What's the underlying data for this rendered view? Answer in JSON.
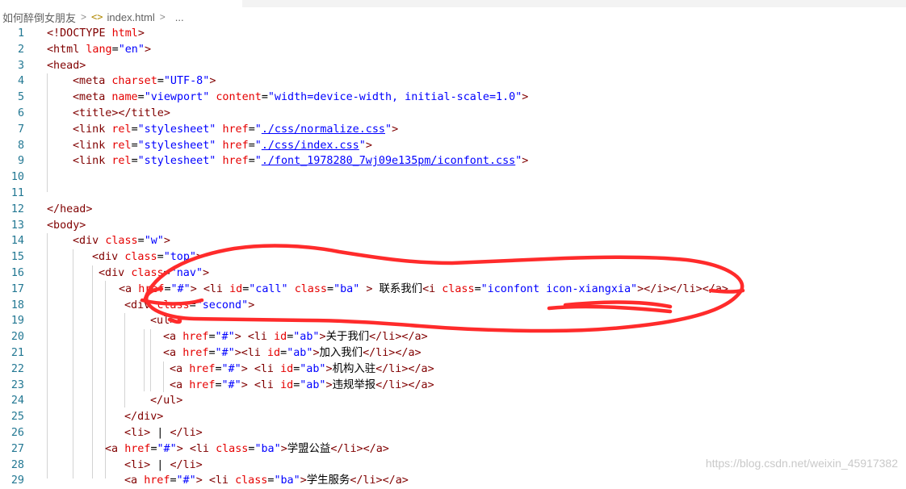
{
  "breadcrumb": {
    "folder": "如何醉倒女朋友",
    "separator": ">",
    "file_icon": "code-brackets-icon",
    "file_icon_glyph": "<>",
    "file": "index.html",
    "more": "..."
  },
  "editor": {
    "lines": [
      {
        "n": "1",
        "segs": [
          [
            "t",
            "<!DOCTYPE "
          ],
          [
            "a",
            "html"
          ],
          [
            "t",
            ">"
          ]
        ]
      },
      {
        "n": "2",
        "segs": [
          [
            "t",
            "<html "
          ],
          [
            "a",
            "lang"
          ],
          [
            "x",
            "="
          ],
          [
            "v",
            "\"en\""
          ],
          [
            "t",
            ">"
          ]
        ]
      },
      {
        "n": "3",
        "segs": [
          [
            "t",
            "<head>"
          ]
        ]
      },
      {
        "n": "4",
        "segs": [
          [
            "t",
            "<meta "
          ],
          [
            "a",
            "charset"
          ],
          [
            "x",
            "="
          ],
          [
            "v",
            "\"UTF-8\""
          ],
          [
            "t",
            ">"
          ]
        ]
      },
      {
        "n": "5",
        "segs": [
          [
            "t",
            "<meta "
          ],
          [
            "a",
            "name"
          ],
          [
            "x",
            "="
          ],
          [
            "v",
            "\"viewport\""
          ],
          [
            "x",
            " "
          ],
          [
            "a",
            "content"
          ],
          [
            "x",
            "="
          ],
          [
            "v",
            "\"width=device-width, initial-scale=1.0\""
          ],
          [
            "t",
            ">"
          ]
        ]
      },
      {
        "n": "6",
        "segs": [
          [
            "t",
            "<title></title>"
          ]
        ]
      },
      {
        "n": "7",
        "segs": [
          [
            "t",
            "<link "
          ],
          [
            "a",
            "rel"
          ],
          [
            "x",
            "="
          ],
          [
            "v",
            "\"stylesheet\""
          ],
          [
            "x",
            " "
          ],
          [
            "a",
            "href"
          ],
          [
            "x",
            "="
          ],
          [
            "v",
            "\""
          ],
          [
            "u",
            "./css/normalize.css"
          ],
          [
            "v",
            "\""
          ],
          [
            "t",
            ">"
          ]
        ]
      },
      {
        "n": "8",
        "segs": [
          [
            "t",
            "<link "
          ],
          [
            "a",
            "rel"
          ],
          [
            "x",
            "="
          ],
          [
            "v",
            "\"stylesheet\""
          ],
          [
            "x",
            " "
          ],
          [
            "a",
            "href"
          ],
          [
            "x",
            "="
          ],
          [
            "v",
            "\""
          ],
          [
            "u",
            "./css/index.css"
          ],
          [
            "v",
            "\""
          ],
          [
            "t",
            ">"
          ]
        ]
      },
      {
        "n": "9",
        "segs": [
          [
            "t",
            "<link "
          ],
          [
            "a",
            "rel"
          ],
          [
            "x",
            "="
          ],
          [
            "v",
            "\"stylesheet\""
          ],
          [
            "x",
            " "
          ],
          [
            "a",
            "href"
          ],
          [
            "x",
            "="
          ],
          [
            "v",
            "\""
          ],
          [
            "u",
            "./font_1978280_7wj09e135pm/iconfont.css"
          ],
          [
            "v",
            "\""
          ],
          [
            "t",
            ">"
          ]
        ]
      },
      {
        "n": "10",
        "segs": []
      },
      {
        "n": "11",
        "segs": []
      },
      {
        "n": "12",
        "segs": [
          [
            "t",
            "</head>"
          ]
        ]
      },
      {
        "n": "13",
        "segs": [
          [
            "t",
            "<body>"
          ]
        ]
      },
      {
        "n": "14",
        "segs": [
          [
            "t",
            "<div "
          ],
          [
            "a",
            "class"
          ],
          [
            "x",
            "="
          ],
          [
            "v",
            "\"w\""
          ],
          [
            "t",
            ">"
          ]
        ]
      },
      {
        "n": "15",
        "segs": [
          [
            "t",
            "<div "
          ],
          [
            "a",
            "class"
          ],
          [
            "x",
            "="
          ],
          [
            "v",
            "\"top\""
          ],
          [
            "t",
            ">"
          ]
        ]
      },
      {
        "n": "16",
        "segs": [
          [
            "t",
            "<div "
          ],
          [
            "a",
            "class"
          ],
          [
            "x",
            "="
          ],
          [
            "v",
            "\"nav\""
          ],
          [
            "t",
            ">"
          ]
        ]
      },
      {
        "n": "17",
        "segs": [
          [
            "t",
            "<a "
          ],
          [
            "a",
            "href"
          ],
          [
            "x",
            "="
          ],
          [
            "v",
            "\"#\""
          ],
          [
            "t",
            ">"
          ],
          [
            "x",
            " "
          ],
          [
            "t",
            "<li "
          ],
          [
            "a",
            "id"
          ],
          [
            "x",
            "="
          ],
          [
            "v",
            "\"call\""
          ],
          [
            "x",
            " "
          ],
          [
            "a",
            "class"
          ],
          [
            "x",
            "="
          ],
          [
            "v",
            "\"ba\""
          ],
          [
            "x",
            " "
          ],
          [
            "t",
            ">"
          ],
          [
            "x",
            " 联系我们"
          ],
          [
            "t",
            "<i "
          ],
          [
            "a",
            "class"
          ],
          [
            "x",
            "="
          ],
          [
            "v",
            "\"iconfont icon-xiangxia\""
          ],
          [
            "t",
            "></i></li></a>"
          ]
        ]
      },
      {
        "n": "18",
        "segs": [
          [
            "t",
            "<div "
          ],
          [
            "a",
            "class"
          ],
          [
            "x",
            "="
          ],
          [
            "v",
            "\"second\""
          ],
          [
            "t",
            ">"
          ]
        ]
      },
      {
        "n": "19",
        "segs": [
          [
            "t",
            "<ul>"
          ]
        ]
      },
      {
        "n": "20",
        "segs": [
          [
            "t",
            "<a "
          ],
          [
            "a",
            "href"
          ],
          [
            "x",
            "="
          ],
          [
            "v",
            "\"#\""
          ],
          [
            "t",
            ">"
          ],
          [
            "x",
            " "
          ],
          [
            "t",
            "<li "
          ],
          [
            "a",
            "id"
          ],
          [
            "x",
            "="
          ],
          [
            "v",
            "\"ab\""
          ],
          [
            "t",
            ">"
          ],
          [
            "x",
            "关于我们"
          ],
          [
            "t",
            "</li></a>"
          ]
        ]
      },
      {
        "n": "21",
        "segs": [
          [
            "t",
            "<a "
          ],
          [
            "a",
            "href"
          ],
          [
            "x",
            "="
          ],
          [
            "v",
            "\"#\""
          ],
          [
            "t",
            ">"
          ],
          [
            "t",
            "<li "
          ],
          [
            "a",
            "id"
          ],
          [
            "x",
            "="
          ],
          [
            "v",
            "\"ab\""
          ],
          [
            "t",
            ">"
          ],
          [
            "x",
            "加入我们"
          ],
          [
            "t",
            "</li></a>"
          ]
        ]
      },
      {
        "n": "22",
        "segs": [
          [
            "t",
            "<a "
          ],
          [
            "a",
            "href"
          ],
          [
            "x",
            "="
          ],
          [
            "v",
            "\"#\""
          ],
          [
            "t",
            ">"
          ],
          [
            "x",
            " "
          ],
          [
            "t",
            "<li "
          ],
          [
            "a",
            "id"
          ],
          [
            "x",
            "="
          ],
          [
            "v",
            "\"ab\""
          ],
          [
            "t",
            ">"
          ],
          [
            "x",
            "机构入驻"
          ],
          [
            "t",
            "</li></a>"
          ]
        ]
      },
      {
        "n": "23",
        "segs": [
          [
            "t",
            "<a "
          ],
          [
            "a",
            "href"
          ],
          [
            "x",
            "="
          ],
          [
            "v",
            "\"#\""
          ],
          [
            "t",
            ">"
          ],
          [
            "x",
            " "
          ],
          [
            "t",
            "<li "
          ],
          [
            "a",
            "id"
          ],
          [
            "x",
            "="
          ],
          [
            "v",
            "\"ab\""
          ],
          [
            "t",
            ">"
          ],
          [
            "x",
            "违规举报"
          ],
          [
            "t",
            "</li></a>"
          ]
        ]
      },
      {
        "n": "24",
        "segs": [
          [
            "t",
            "</ul>"
          ]
        ]
      },
      {
        "n": "25",
        "segs": [
          [
            "t",
            "</div>"
          ]
        ]
      },
      {
        "n": "26",
        "segs": [
          [
            "t",
            "<li>"
          ],
          [
            "x",
            " | "
          ],
          [
            "t",
            "</li>"
          ]
        ]
      },
      {
        "n": "27",
        "segs": [
          [
            "t",
            "<a "
          ],
          [
            "a",
            "href"
          ],
          [
            "x",
            "="
          ],
          [
            "v",
            "\"#\""
          ],
          [
            "t",
            ">"
          ],
          [
            "x",
            " "
          ],
          [
            "t",
            "<li "
          ],
          [
            "a",
            "class"
          ],
          [
            "x",
            "="
          ],
          [
            "v",
            "\"ba\""
          ],
          [
            "t",
            ">"
          ],
          [
            "x",
            "学盟公益"
          ],
          [
            "t",
            "</li></a>"
          ]
        ]
      },
      {
        "n": "28",
        "segs": [
          [
            "t",
            "<li>"
          ],
          [
            "x",
            " | "
          ],
          [
            "t",
            "</li>"
          ]
        ]
      },
      {
        "n": "29",
        "segs": [
          [
            "t",
            "<a "
          ],
          [
            "a",
            "href"
          ],
          [
            "x",
            "="
          ],
          [
            "v",
            "\"#\""
          ],
          [
            "t",
            ">"
          ],
          [
            "x",
            " "
          ],
          [
            "t",
            "<li "
          ],
          [
            "a",
            "class"
          ],
          [
            "x",
            "="
          ],
          [
            "v",
            "\"ba\""
          ],
          [
            "t",
            ">"
          ],
          [
            "x",
            "学生服务"
          ],
          [
            "t",
            "</li></a>"
          ]
        ]
      }
    ]
  },
  "annotation": {
    "color": "#ff2b2b",
    "kind": "red-freehand-circle"
  },
  "watermark": "https://blog.csdn.net/weixin_45917382",
  "colors": {
    "tag": "#800000",
    "attr": "#e50000",
    "value": "#0000ff",
    "text": "#000000",
    "line_number": "#237893",
    "indent_guide": "#d3d3d3"
  }
}
